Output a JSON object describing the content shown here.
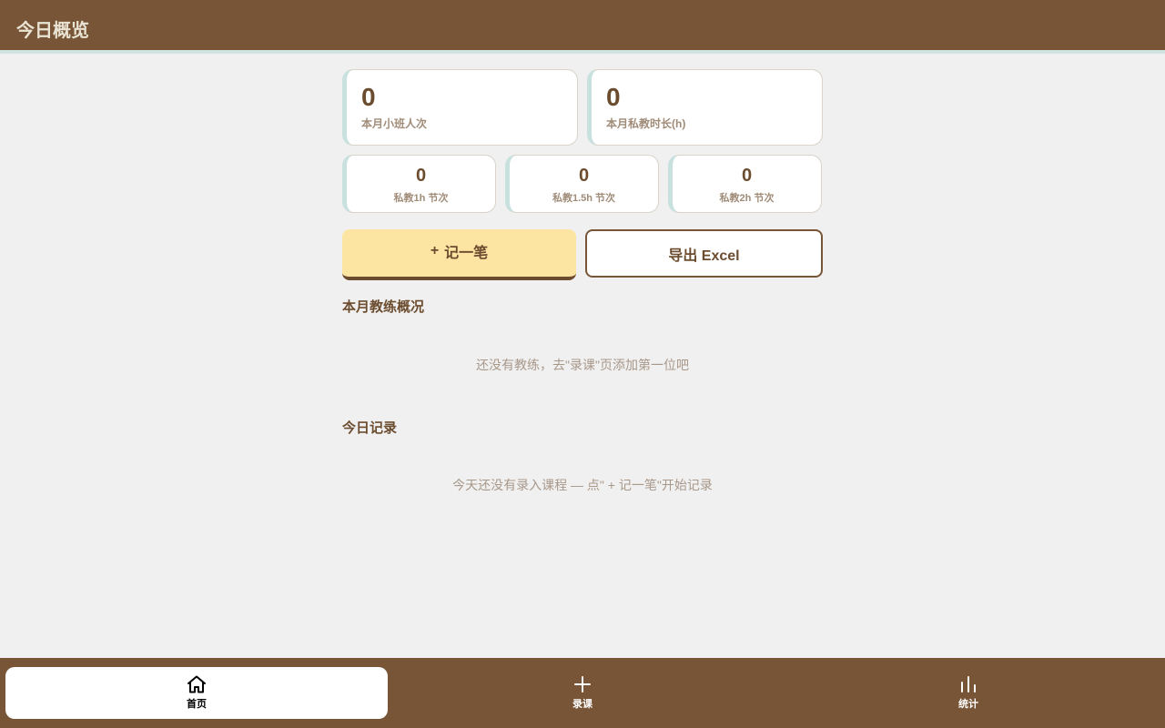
{
  "header": {
    "title": "今日概览"
  },
  "stats_big": [
    {
      "value": "0",
      "label": "本月小班人次"
    },
    {
      "value": "0",
      "label": "本月私教时长(h)"
    }
  ],
  "stats_small": [
    {
      "value": "0",
      "label": "私教1h 节次"
    },
    {
      "value": "0",
      "label": "私教1.5h 节次"
    },
    {
      "value": "0",
      "label": "私教2h 节次"
    }
  ],
  "actions": {
    "add_icon": "+",
    "add_label": "记一笔",
    "export_label": "导出 Excel"
  },
  "coaches": {
    "title": "本月教练概况",
    "empty_text": "还没有教练，去\"录课\"页添加第一位吧"
  },
  "today": {
    "title": "今日记录",
    "empty_text": "今天还没有录入课程 — 点\" + 记一笔\"开始记录"
  },
  "tabs": [
    {
      "label": "首页",
      "icon": "home-icon",
      "active": true
    },
    {
      "label": "录课",
      "icon": "plus-icon",
      "active": false
    },
    {
      "label": "统计",
      "icon": "bar-chart-icon",
      "active": false
    }
  ],
  "colors": {
    "brand_brown": "#785536",
    "accent_teal": "#c9e1de",
    "add_button_bg": "#fce4a3",
    "background": "#f0f0f0"
  }
}
